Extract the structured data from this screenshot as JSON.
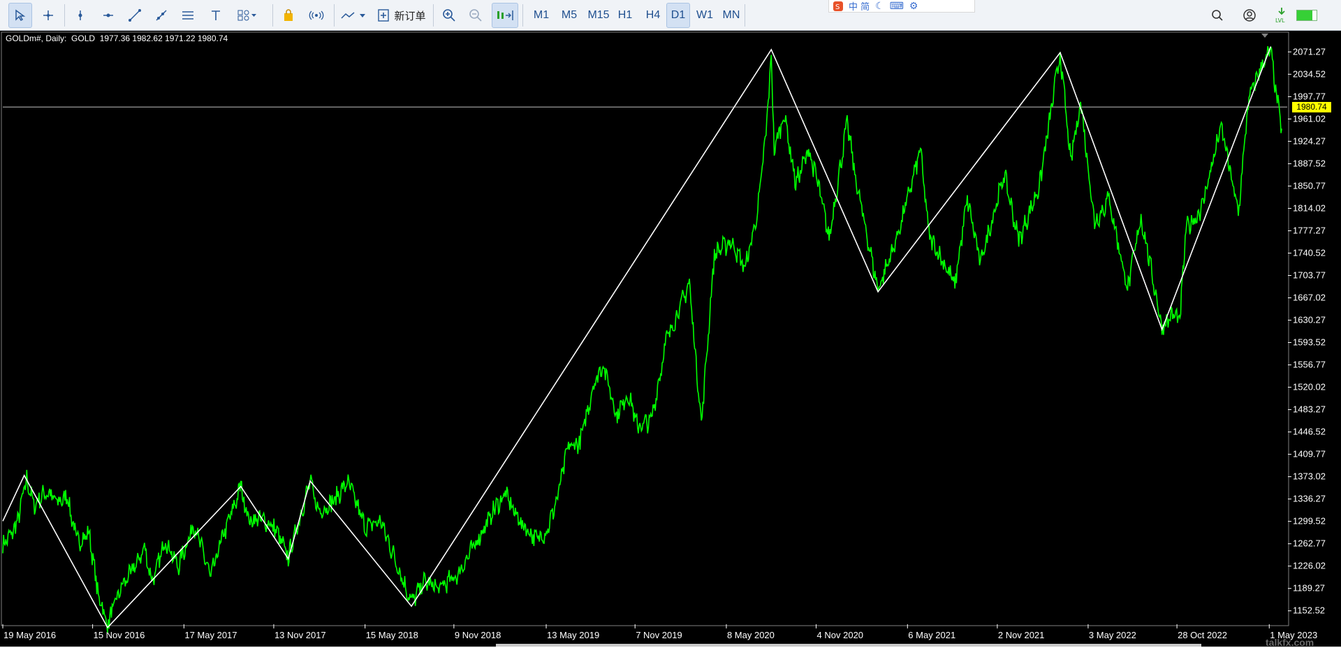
{
  "toolbar": {
    "tools": [
      {
        "name": "cursor-tool",
        "icon": "↖",
        "active": true
      },
      {
        "name": "crosshair-tool",
        "icon": "+"
      },
      {
        "name": "vertical-line-tool",
        "icon": "│"
      },
      {
        "name": "horizontal-line-tool",
        "icon": "─"
      },
      {
        "name": "trend-line-tool",
        "icon": "∕"
      },
      {
        "name": "ray-tool",
        "icon": "↗"
      },
      {
        "name": "channel-tool",
        "icon": "≡"
      },
      {
        "name": "text-tool",
        "icon": "T"
      },
      {
        "name": "shapes-tool",
        "icon": "◇"
      }
    ],
    "new_order_label": "新订单",
    "timeframes": [
      "M1",
      "M5",
      "M15",
      "H1",
      "H4",
      "D1",
      "W1",
      "MN"
    ],
    "active_timeframe": "D1",
    "ime_text": "中 简"
  },
  "chart": {
    "info": "GOLDm#, Daily:  GOLD  1977.36 1982.62 1971.22 1980.74",
    "current_price_label": "1980.74",
    "watermark": "talkfx.com",
    "colors": {
      "background": "#000000",
      "price": "#00ff00",
      "zigzag": "#ffffff",
      "tag": "#ffff00"
    }
  },
  "chart_data": {
    "type": "line",
    "symbol": "GOLDm#",
    "timeframe": "Daily",
    "y_ticks": [
      "2071.27",
      "2034.52",
      "1997.77",
      "1961.02",
      "1924.27",
      "1887.52",
      "1850.77",
      "1814.02",
      "1777.27",
      "1740.52",
      "1703.77",
      "1667.02",
      "1630.27",
      "1593.52",
      "1556.77",
      "1520.02",
      "1483.27",
      "1446.52",
      "1409.77",
      "1373.02",
      "1336.27",
      "1299.52",
      "1262.77",
      "1226.02",
      "1189.27",
      "1152.52"
    ],
    "x_ticks": [
      "19 May 2016",
      "15 Nov 2016",
      "17 May 2017",
      "13 Nov 2017",
      "15 May 2018",
      "9 Nov 2018",
      "13 May 2019",
      "7 Nov 2019",
      "8 May 2020",
      "4 Nov 2020",
      "6 May 2021",
      "2 Nov 2021",
      "3 May 2022",
      "28 Oct 2022",
      "1 May 2023"
    ],
    "ylim": [
      1135,
      2090
    ],
    "last_price": 1980.74,
    "series": [
      {
        "values": [
          [
            "2016-05-19",
            1260
          ],
          [
            "2016-06-15",
            1290
          ],
          [
            "2016-07-06",
            1370
          ],
          [
            "2016-07-20",
            1325
          ],
          [
            "2016-08-15",
            1350
          ],
          [
            "2016-09-05",
            1330
          ],
          [
            "2016-09-25",
            1340
          ],
          [
            "2016-10-15",
            1265
          ],
          [
            "2016-11-08",
            1280
          ],
          [
            "2016-11-25",
            1185
          ],
          [
            "2016-12-15",
            1130
          ],
          [
            "2017-01-10",
            1190
          ],
          [
            "2017-02-01",
            1215
          ],
          [
            "2017-02-27",
            1255
          ],
          [
            "2017-03-15",
            1198
          ],
          [
            "2017-04-10",
            1270
          ],
          [
            "2017-05-05",
            1225
          ],
          [
            "2017-06-06",
            1295
          ],
          [
            "2017-07-10",
            1208
          ],
          [
            "2017-08-01",
            1270
          ],
          [
            "2017-09-08",
            1355
          ],
          [
            "2017-09-25",
            1300
          ],
          [
            "2017-10-16",
            1305
          ],
          [
            "2017-11-15",
            1290
          ],
          [
            "2017-12-12",
            1240
          ],
          [
            "2018-01-25",
            1365
          ],
          [
            "2018-02-10",
            1315
          ],
          [
            "2018-03-10",
            1330
          ],
          [
            "2018-04-11",
            1365
          ],
          [
            "2018-05-15",
            1290
          ],
          [
            "2018-06-15",
            1300
          ],
          [
            "2018-07-20",
            1225
          ],
          [
            "2018-08-16",
            1165
          ],
          [
            "2018-09-10",
            1200
          ],
          [
            "2018-10-10",
            1190
          ],
          [
            "2018-11-15",
            1210
          ],
          [
            "2018-12-20",
            1260
          ],
          [
            "2019-01-30",
            1320
          ],
          [
            "2019-02-20",
            1345
          ],
          [
            "2019-03-20",
            1300
          ],
          [
            "2019-04-23",
            1270
          ],
          [
            "2019-05-15",
            1285
          ],
          [
            "2019-06-05",
            1340
          ],
          [
            "2019-06-25",
            1420
          ],
          [
            "2019-07-20",
            1430
          ],
          [
            "2019-08-15",
            1520
          ],
          [
            "2019-09-04",
            1560
          ],
          [
            "2019-10-01",
            1475
          ],
          [
            "2019-10-25",
            1510
          ],
          [
            "2019-11-12",
            1455
          ],
          [
            "2019-12-10",
            1465
          ],
          [
            "2020-01-08",
            1595
          ],
          [
            "2020-02-24",
            1690
          ],
          [
            "2020-03-19",
            1460
          ],
          [
            "2020-04-14",
            1740
          ],
          [
            "2020-05-18",
            1760
          ],
          [
            "2020-06-15",
            1715
          ],
          [
            "2020-07-10",
            1810
          ],
          [
            "2020-07-28",
            1950
          ],
          [
            "2020-08-06",
            2070
          ],
          [
            "2020-08-12",
            1910
          ],
          [
            "2020-09-01",
            1970
          ],
          [
            "2020-09-24",
            1855
          ],
          [
            "2020-10-20",
            1910
          ],
          [
            "2020-11-09",
            1850
          ],
          [
            "2020-11-30",
            1765
          ],
          [
            "2021-01-05",
            1955
          ],
          [
            "2021-01-25",
            1850
          ],
          [
            "2021-03-08",
            1680
          ],
          [
            "2021-04-15",
            1765
          ],
          [
            "2021-06-01",
            1910
          ],
          [
            "2021-06-18",
            1770
          ],
          [
            "2021-08-09",
            1690
          ],
          [
            "2021-09-03",
            1830
          ],
          [
            "2021-09-29",
            1725
          ],
          [
            "2021-11-16",
            1870
          ],
          [
            "2021-12-15",
            1760
          ],
          [
            "2022-01-25",
            1850
          ],
          [
            "2022-03-08",
            2070
          ],
          [
            "2022-03-29",
            1890
          ],
          [
            "2022-04-18",
            1990
          ],
          [
            "2022-05-16",
            1790
          ],
          [
            "2022-06-14",
            1830
          ],
          [
            "2022-07-21",
            1680
          ],
          [
            "2022-08-17",
            1800
          ],
          [
            "2022-09-28",
            1620
          ],
          [
            "2022-10-21",
            1640
          ],
          [
            "2022-11-03",
            1630
          ],
          [
            "2022-11-15",
            1780
          ],
          [
            "2022-12-15",
            1810
          ],
          [
            "2023-01-25",
            1950
          ],
          [
            "2023-02-28",
            1805
          ],
          [
            "2023-03-20",
            1990
          ],
          [
            "2023-04-13",
            2045
          ],
          [
            "2023-05-04",
            2072
          ],
          [
            "2023-05-17",
            1990
          ],
          [
            "2023-05-26",
            1945
          ]
        ]
      }
    ],
    "zigzag": [
      [
        "2016-05-19",
        1300
      ],
      [
        "2016-07-01",
        1375
      ],
      [
        "2016-12-15",
        1125
      ],
      [
        "2017-09-08",
        1357
      ],
      [
        "2017-12-12",
        1238
      ],
      [
        "2018-01-25",
        1366
      ],
      [
        "2018-08-16",
        1160
      ],
      [
        "2020-08-06",
        2075
      ],
      [
        "2021-03-08",
        1677
      ],
      [
        "2022-03-08",
        2070
      ],
      [
        "2022-09-28",
        1615
      ],
      [
        "2023-05-04",
        2080
      ]
    ]
  }
}
